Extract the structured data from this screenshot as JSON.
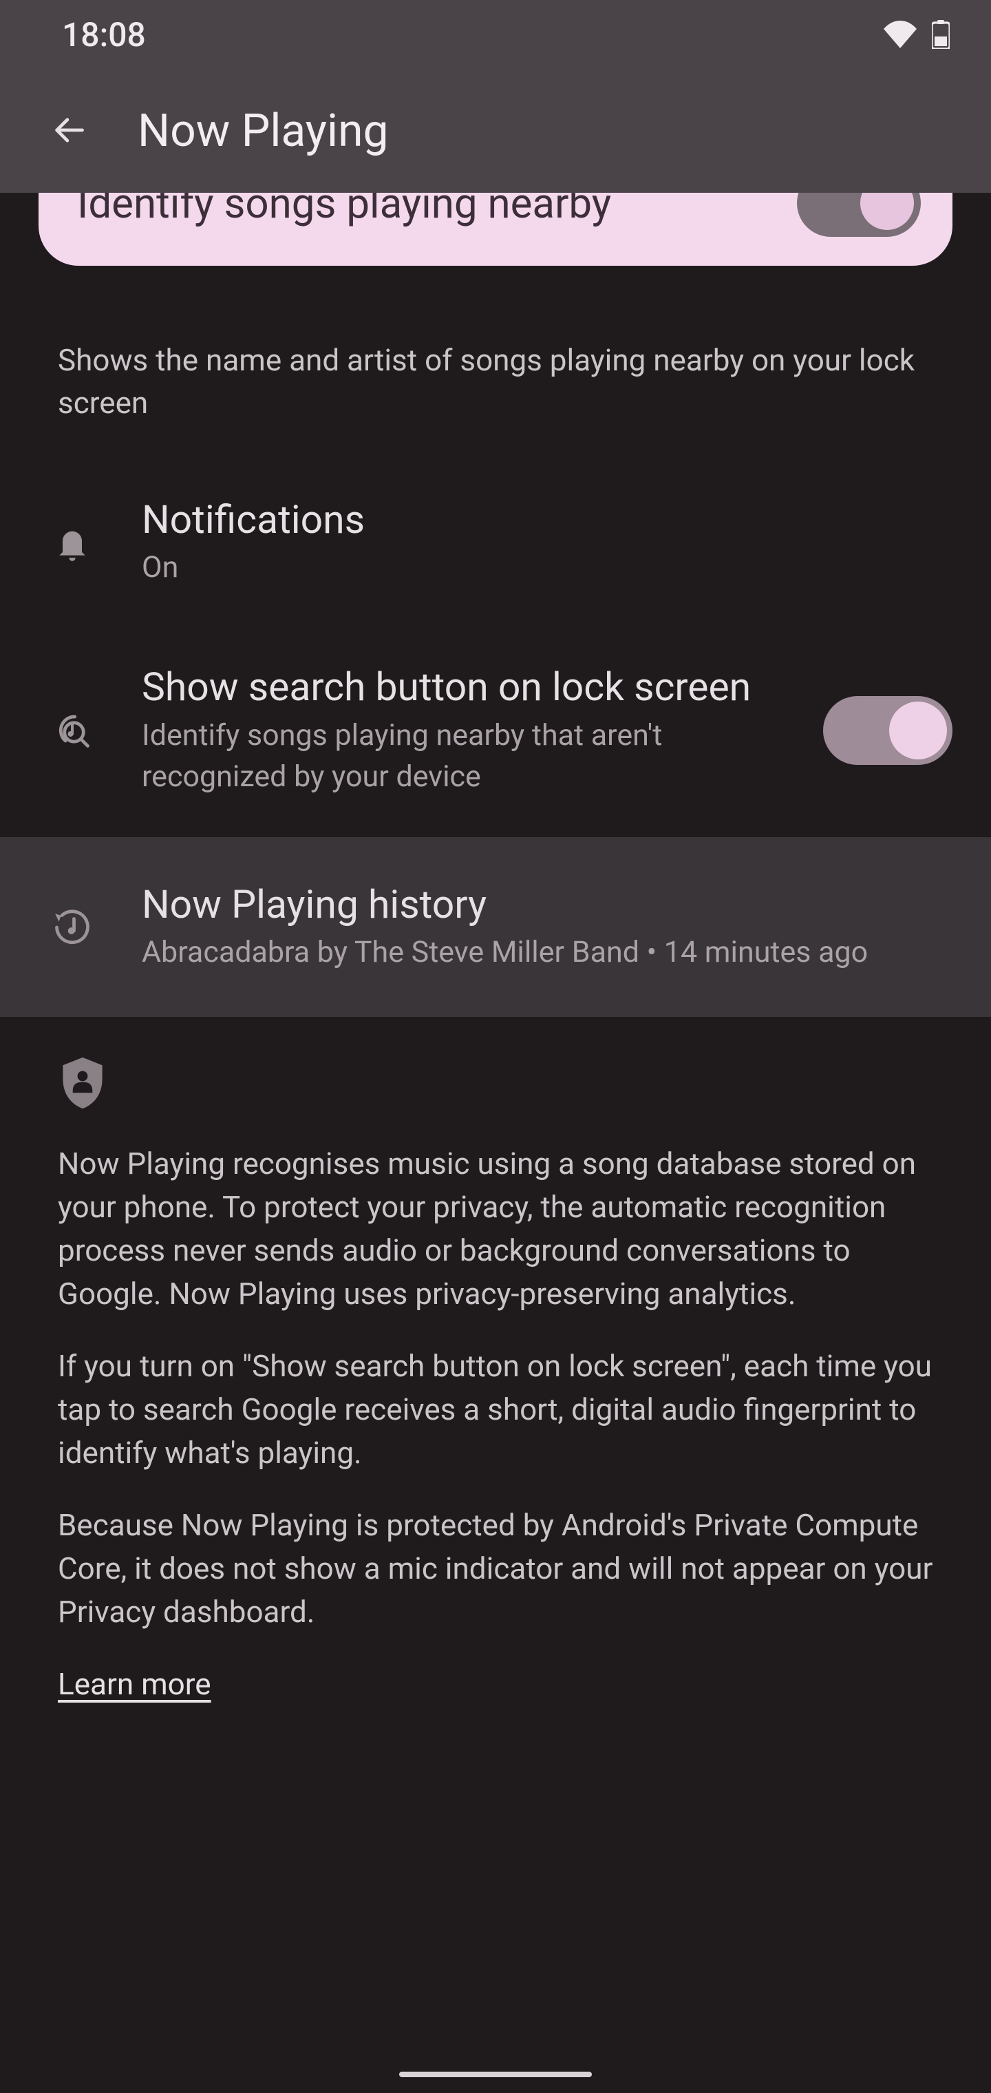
{
  "status_bar": {
    "time": "18:08"
  },
  "app_bar": {
    "title": "Now Playing"
  },
  "hero": {
    "label": "Identify songs playing nearby"
  },
  "description": "Shows the name and artist of songs playing nearby on your lock screen",
  "rows": {
    "notifications": {
      "title": "Notifications",
      "subtitle": "On"
    },
    "search": {
      "title": "Show search button on lock screen",
      "subtitle": "Identify songs playing nearby that aren't recognized by your device"
    },
    "history": {
      "title": "Now Playing history",
      "subtitle": "Abracadabra by The Steve Miller Band • 14 minutes ago"
    }
  },
  "privacy": {
    "p1": "Now Playing recognises music using a song database stored on your phone. To protect your privacy, the automatic recognition process never sends audio or background conversations to Google. Now Playing uses privacy-preserving analytics.",
    "p2": "If you turn on \"Show search button on lock screen\", each time you tap to search Google receives a short, digital audio fingerprint to identify what's playing.",
    "p3": "Because Now Playing is protected by Android's Private Compute Core, it does not show a mic indicator and will not appear on your Privacy dashboard.",
    "learn_more": "Learn more"
  }
}
